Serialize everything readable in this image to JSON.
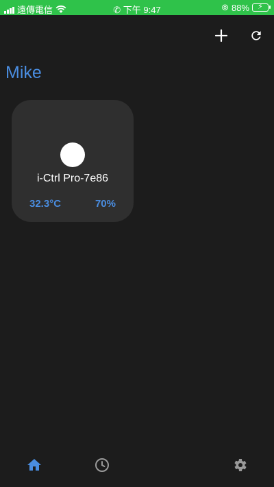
{
  "status_bar": {
    "carrier": "遠傳電信",
    "time": "下午 9:47",
    "battery": "88%"
  },
  "header": {
    "user_name": "Mike"
  },
  "devices": [
    {
      "name": "i-Ctrl Pro-7e86",
      "temperature": "32.3°C",
      "humidity": "70%"
    }
  ],
  "icons": {
    "add": "plus-icon",
    "refresh": "refresh-icon",
    "home": "home-icon",
    "history": "clock-icon",
    "settings": "gear-icon"
  },
  "colors": {
    "accent": "#4a8de0",
    "background": "#1c1c1c",
    "card": "#2f2f2f",
    "status_bar": "#2fc24a"
  }
}
